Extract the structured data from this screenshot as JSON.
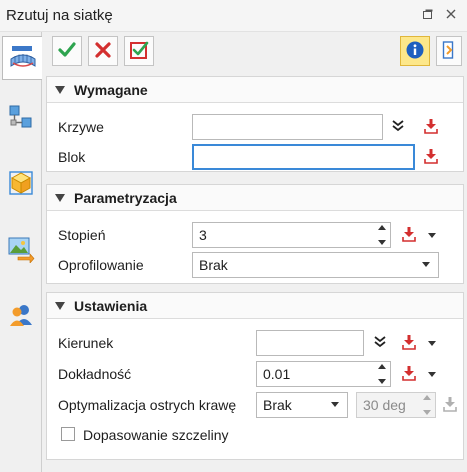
{
  "window": {
    "title": "Rzutuj na siatkę"
  },
  "sidebar": {
    "tabs": [
      {
        "icon": "project-mesh-icon",
        "active": true
      },
      {
        "icon": "tree-structure-icon",
        "active": false
      },
      {
        "icon": "box-3d-icon",
        "active": false
      },
      {
        "icon": "image-texture-icon",
        "active": false
      },
      {
        "icon": "user-icon",
        "active": false
      }
    ]
  },
  "toolbar": {
    "ok_icon": "check-icon",
    "cancel_icon": "cross-icon",
    "apply_icon": "checkbox-apply-icon",
    "info_icon": "info-icon",
    "next_icon": "next-panel-icon"
  },
  "sections": {
    "required": {
      "title": "Wymagane",
      "curves_label": "Krzywe",
      "curves_value": "",
      "block_label": "Blok",
      "block_value": ""
    },
    "parametrization": {
      "title": "Parametryzacja",
      "degree_label": "Stopień",
      "degree_value": "3",
      "profiling_label": "Oprofilowanie",
      "profiling_value": "Brak"
    },
    "settings": {
      "title": "Ustawienia",
      "direction_label": "Kierunek",
      "direction_value": "",
      "accuracy_label": "Dokładność",
      "accuracy_value": "0.01",
      "sharp_edges_label": "Optymalizacja ostrych krawę",
      "sharp_edges_value": "Brak",
      "angle_value": "30 deg",
      "gap_label": "Dopasowanie szczeliny",
      "gap_checked": false
    }
  },
  "colors": {
    "accent_blue": "#3a89d8",
    "check_green": "#2ea44f",
    "cross_red": "#d32f2f",
    "info_highlight": "#fde78a"
  }
}
